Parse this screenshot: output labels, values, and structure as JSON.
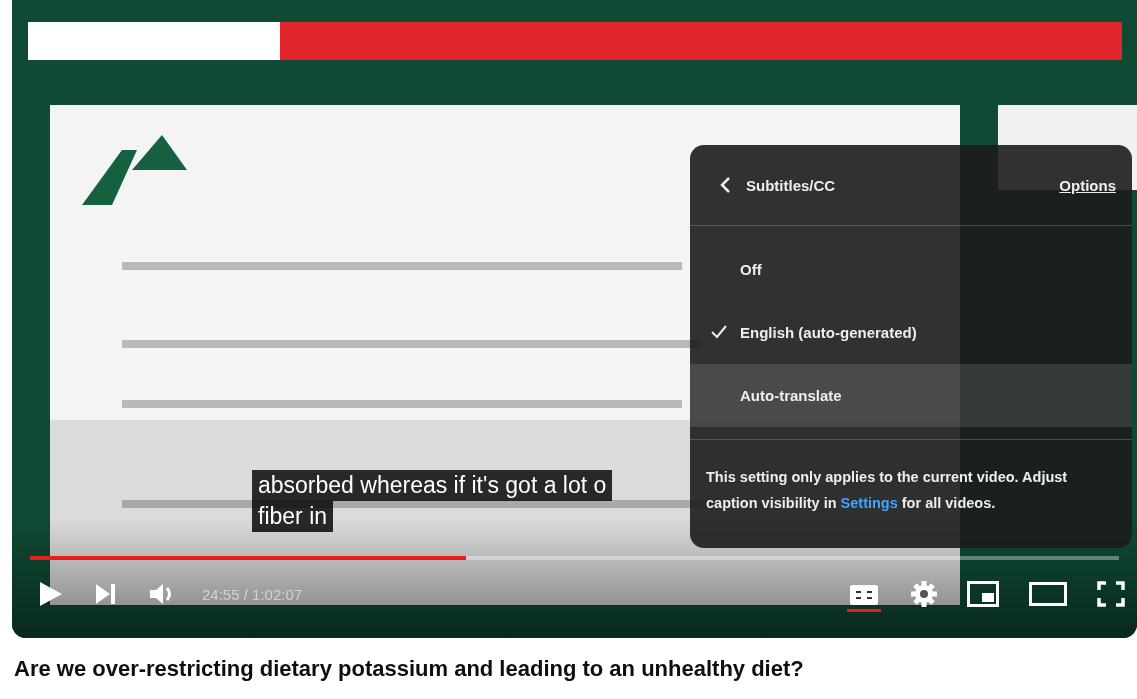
{
  "captions": [
    "absorbed whereas if it's got a lot o",
    "fiber in"
  ],
  "subtitles_menu": {
    "title": "Subtitles/CC",
    "options_link": "Options",
    "items": [
      {
        "label": "Off",
        "selected": false,
        "highlighted": false
      },
      {
        "label": "English (auto-generated)",
        "selected": true,
        "highlighted": false
      },
      {
        "label": "Auto-translate",
        "selected": false,
        "highlighted": true
      }
    ],
    "note_before": "This setting only applies to the current video. Adjust caption visibility in",
    "note_link": "Settings",
    "note_after": "for all videos."
  },
  "controls": {
    "progress": {
      "level": 0.4
    },
    "time": "24:55 / 1:02:07",
    "captions_on": true
  },
  "title": "Are we over-restricting dietary potassium and leading to an unhealthy diet?"
}
